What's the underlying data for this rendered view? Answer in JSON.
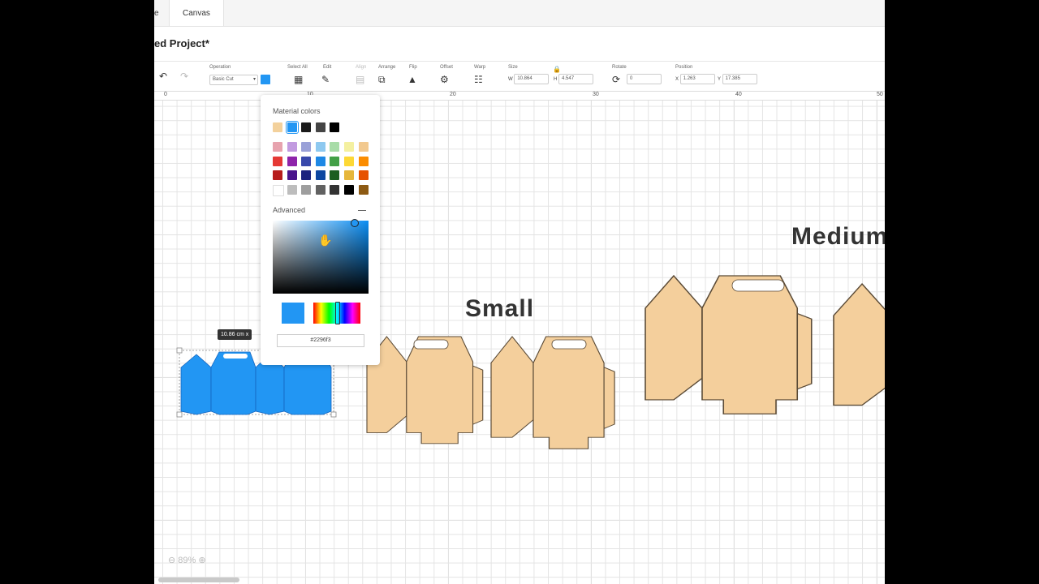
{
  "tabs": {
    "partial": "e",
    "active": "Canvas"
  },
  "project_title": "ed Project*",
  "toolbar": {
    "operation_label": "Operation",
    "operation_value": "Basic Cut",
    "select_all_label": "Select All",
    "edit_label": "Edit",
    "align_label": "Align",
    "arrange_label": "Arrange",
    "flip_label": "Flip",
    "offset_label": "Offset",
    "warp_label": "Warp",
    "size_label": "Size",
    "w_label": "W",
    "w_value": "10.864",
    "h_label": "H",
    "h_value": "4.547",
    "rotate_label": "Rotate",
    "rotate_value": "0",
    "position_label": "Position",
    "x_label": "X",
    "x_value": "1.263",
    "y_label": "Y",
    "y_value": "17.385"
  },
  "ruler": [
    "0",
    "10",
    "20",
    "30",
    "40",
    "50"
  ],
  "color_picker": {
    "title": "Material colors",
    "advanced_label": "Advanced",
    "hex_value": "#2296f3",
    "recent": [
      "#f3d19c",
      "#2296f3",
      "#1a1a1a",
      "#444444",
      "#000000"
    ],
    "palette": [
      [
        "#e7a3ae",
        "#c29be0",
        "#9aa1d8",
        "#8ec9f0",
        "#a8dca8",
        "#f4f0a0",
        "#f2c98f"
      ],
      [
        "#e53935",
        "#8e24aa",
        "#3949ab",
        "#1e88e5",
        "#43a047",
        "#fdd835",
        "#fb8c00"
      ],
      [
        "#b71c1c",
        "#4a148c",
        "#1a237e",
        "#0d47a1",
        "#1b5e20",
        "#e6b63b",
        "#e65100"
      ],
      [
        "#ffffff",
        "#bdbdbd",
        "#9e9e9e",
        "#616161",
        "#333333",
        "#000000",
        "#8d5a13"
      ]
    ]
  },
  "canvas": {
    "label_small": "Small",
    "label_medium": "Medium",
    "tooltip": "10.86 cm x",
    "selected_fill": "#2296f3",
    "box_fill": "#f4cf9c",
    "zoom": "89%"
  }
}
